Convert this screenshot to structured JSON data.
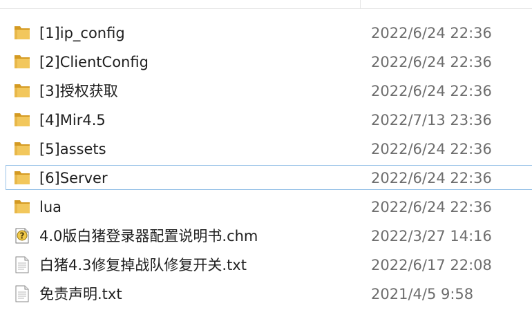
{
  "files": [
    {
      "name": "[1]ip_config",
      "date": "2022/6/24 22:36",
      "icon": "folder-icon"
    },
    {
      "name": "[2]ClientConfig",
      "date": "2022/6/24 22:36",
      "icon": "folder-icon"
    },
    {
      "name": "[3]授权获取",
      "date": "2022/6/24 22:36",
      "icon": "folder-icon"
    },
    {
      "name": "[4]Mir4.5",
      "date": "2022/7/13 23:36",
      "icon": "folder-icon"
    },
    {
      "name": "[5]assets",
      "date": "2022/6/24 22:36",
      "icon": "folder-icon"
    },
    {
      "name": "[6]Server",
      "date": "2022/6/24 22:36",
      "icon": "folder-icon",
      "selected": true
    },
    {
      "name": "lua",
      "date": "2022/6/24 22:36",
      "icon": "folder-icon"
    },
    {
      "name": "4.0版白猪登录器配置说明书.chm",
      "date": "2022/3/27 14:16",
      "icon": "chm-help-file-icon"
    },
    {
      "name": "白猪4.3修复掉战队修复开关.txt",
      "date": "2022/6/17 22:08",
      "icon": "text-file-icon"
    },
    {
      "name": "免责声明.txt",
      "date": "2021/4/5 9:58",
      "icon": "text-file-icon"
    }
  ],
  "colors": {
    "folder": "#e8b84a",
    "folder_dark": "#d49a22",
    "selection_border": "#99c3e8",
    "date_text": "#6d6d6d",
    "name_text": "#1e1e1e"
  }
}
